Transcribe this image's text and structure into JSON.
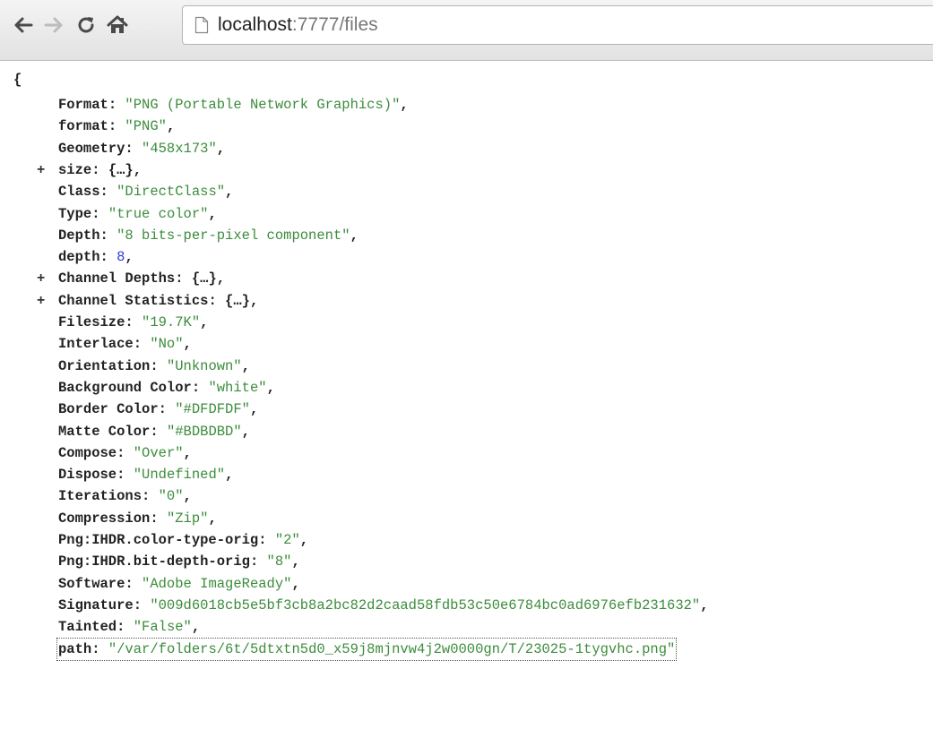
{
  "browser": {
    "back_icon": "back-arrow-icon",
    "forward_icon": "forward-arrow-icon",
    "reload_icon": "reload-icon",
    "home_icon": "home-icon",
    "page_icon": "page-icon",
    "url_host": "localhost",
    "url_rest": ":7777/files"
  },
  "json": {
    "open_brace": "{",
    "lines": [
      {
        "key": "Format",
        "type": "string",
        "value": "\"PNG (Portable Network Graphics)\"",
        "comma": ",",
        "expandable": false
      },
      {
        "key": "format",
        "type": "string",
        "value": "\"PNG\"",
        "comma": ",",
        "expandable": false
      },
      {
        "key": "Geometry",
        "type": "string",
        "value": "\"458x173\"",
        "comma": ",",
        "expandable": false
      },
      {
        "key": "size",
        "type": "object",
        "value": "{…}",
        "comma": ",",
        "expandable": true
      },
      {
        "key": "Class",
        "type": "string",
        "value": "\"DirectClass\"",
        "comma": ",",
        "expandable": false
      },
      {
        "key": "Type",
        "type": "string",
        "value": "\"true color\"",
        "comma": ",",
        "expandable": false
      },
      {
        "key": "Depth",
        "type": "string",
        "value": "\"8 bits-per-pixel component\"",
        "comma": ",",
        "expandable": false
      },
      {
        "key": "depth",
        "type": "number",
        "value": "8",
        "comma": ",",
        "expandable": false
      },
      {
        "key": "Channel Depths",
        "type": "object",
        "value": "{…}",
        "comma": ",",
        "expandable": true
      },
      {
        "key": "Channel Statistics",
        "type": "object",
        "value": "{…}",
        "comma": ",",
        "expandable": true
      },
      {
        "key": "Filesize",
        "type": "string",
        "value": "\"19.7K\"",
        "comma": ",",
        "expandable": false
      },
      {
        "key": "Interlace",
        "type": "string",
        "value": "\"No\"",
        "comma": ",",
        "expandable": false
      },
      {
        "key": "Orientation",
        "type": "string",
        "value": "\"Unknown\"",
        "comma": ",",
        "expandable": false
      },
      {
        "key": "Background Color",
        "type": "string",
        "value": "\"white\"",
        "comma": ",",
        "expandable": false
      },
      {
        "key": "Border Color",
        "type": "string",
        "value": "\"#DFDFDF\"",
        "comma": ",",
        "expandable": false
      },
      {
        "key": "Matte Color",
        "type": "string",
        "value": "\"#BDBDBD\"",
        "comma": ",",
        "expandable": false
      },
      {
        "key": "Compose",
        "type": "string",
        "value": "\"Over\"",
        "comma": ",",
        "expandable": false
      },
      {
        "key": "Dispose",
        "type": "string",
        "value": "\"Undefined\"",
        "comma": ",",
        "expandable": false
      },
      {
        "key": "Iterations",
        "type": "string",
        "value": "\"0\"",
        "comma": ",",
        "expandable": false
      },
      {
        "key": "Compression",
        "type": "string",
        "value": "\"Zip\"",
        "comma": ",",
        "expandable": false
      },
      {
        "key": "Png:IHDR.color-type-orig",
        "type": "string",
        "value": "\"2\"",
        "comma": ",",
        "expandable": false
      },
      {
        "key": "Png:IHDR.bit-depth-orig",
        "type": "string",
        "value": "\"8\"",
        "comma": ",",
        "expandable": false
      },
      {
        "key": "Software",
        "type": "string",
        "value": "\"Adobe ImageReady\"",
        "comma": ",",
        "expandable": false
      },
      {
        "key": "Signature",
        "type": "string",
        "value": "\"009d6018cb5e5bf3cb8a2bc82d2caad58fdb53c50e6784bc0ad6976efb231632\"",
        "comma": ",",
        "expandable": false
      },
      {
        "key": "Tainted",
        "type": "string",
        "value": "\"False\"",
        "comma": ",",
        "expandable": false
      },
      {
        "key": "path",
        "type": "string",
        "value": "\"/var/folders/6t/5dtxtn5d0_x59j8mjnvw4j2w0000gn/T/23025-1tygvhc.png\"",
        "comma": "",
        "expandable": false,
        "selected": true
      }
    ],
    "expander_symbol": "+",
    "colors": {
      "string": "#3c8c3c",
      "number": "#2a3ad1",
      "key": "#222222"
    }
  }
}
